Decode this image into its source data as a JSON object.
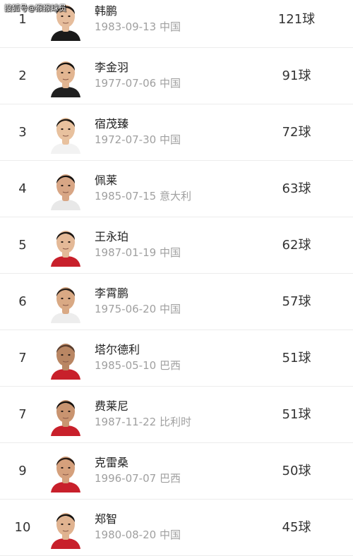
{
  "watermark": "搜狐号@猴猴球员",
  "players": [
    {
      "rank": "1",
      "name": "韩鹏",
      "birth": "1983-09-13",
      "country": "中国",
      "goals": "121球",
      "hair": "#1f1a17",
      "skin": "#e6bd9c",
      "shirt": "#1a1a1a",
      "avatar_icon": "player-portrait"
    },
    {
      "rank": "2",
      "name": "李金羽",
      "birth": "1977-07-06",
      "country": "中国",
      "goals": "91球",
      "hair": "#141210",
      "skin": "#e2b591",
      "shirt": "#202020",
      "avatar_icon": "player-portrait"
    },
    {
      "rank": "3",
      "name": "宿茂臻",
      "birth": "1972-07-30",
      "country": "中国",
      "goals": "72球",
      "hair": "#1c1814",
      "skin": "#e8c19e",
      "shirt": "#f2f2f2",
      "avatar_icon": "player-portrait"
    },
    {
      "rank": "4",
      "name": "佩莱",
      "birth": "1985-07-15",
      "country": "意大利",
      "goals": "63球",
      "hair": "#181412",
      "skin": "#d8a685",
      "shirt": "#e8e8e8",
      "avatar_icon": "player-portrait"
    },
    {
      "rank": "5",
      "name": "王永珀",
      "birth": "1987-01-19",
      "country": "中国",
      "goals": "62球",
      "hair": "#1a1613",
      "skin": "#e4b997",
      "shirt": "#c8202b",
      "avatar_icon": "player-portrait"
    },
    {
      "rank": "6",
      "name": "李霄鹏",
      "birth": "1975-06-20",
      "country": "中国",
      "goals": "57球",
      "hair": "#2a211b",
      "skin": "#d9a984",
      "shirt": "#ededed",
      "avatar_icon": "player-portrait"
    },
    {
      "rank": "7",
      "name": "塔尔德利",
      "birth": "1985-05-10",
      "country": "巴西",
      "goals": "51球",
      "hair": "#5a3e2e",
      "skin": "#b98663",
      "shirt": "#c8202b",
      "avatar_icon": "player-portrait"
    },
    {
      "rank": "7",
      "name": "费莱尼",
      "birth": "1987-11-22",
      "country": "比利时",
      "goals": "51球",
      "hair": "#15110f",
      "skin": "#c99470",
      "shirt": "#c8202b",
      "avatar_icon": "player-portrait"
    },
    {
      "rank": "9",
      "name": "克雷桑",
      "birth": "1996-07-07",
      "country": "巴西",
      "goals": "50球",
      "hair": "#2b1d16",
      "skin": "#d5a07c",
      "shirt": "#c8202b",
      "avatar_icon": "player-portrait"
    },
    {
      "rank": "10",
      "name": "郑智",
      "birth": "1980-08-20",
      "country": "中国",
      "goals": "45球",
      "hair": "#141210",
      "skin": "#e0b390",
      "shirt": "#c8202b",
      "avatar_icon": "player-portrait"
    }
  ]
}
